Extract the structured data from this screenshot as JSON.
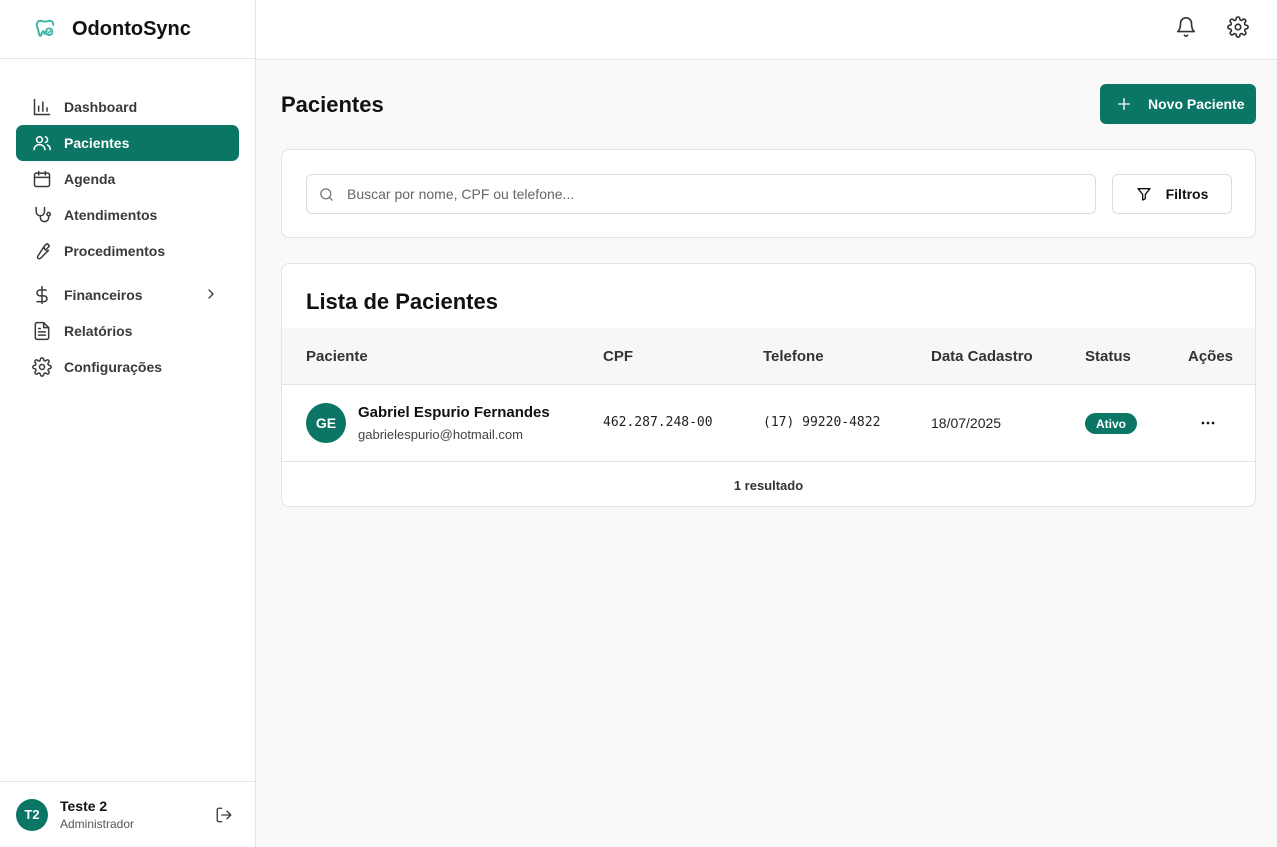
{
  "brand": {
    "name": "OdontoSync",
    "icon": "tooth-icon",
    "accent": "#0b7566"
  },
  "sidebar": {
    "items": [
      {
        "label": "Dashboard",
        "icon": "bar-chart-icon",
        "active": false
      },
      {
        "label": "Pacientes",
        "icon": "users-icon",
        "active": true
      },
      {
        "label": "Agenda",
        "icon": "calendar-icon",
        "active": false
      },
      {
        "label": "Atendimentos",
        "icon": "stethoscope-icon",
        "active": false
      },
      {
        "label": "Procedimentos",
        "icon": "wrench-icon",
        "active": false
      },
      {
        "label": "Financeiros",
        "icon": "dollar-icon",
        "active": false,
        "has_submenu": true
      },
      {
        "label": "Relatórios",
        "icon": "file-text-icon",
        "active": false
      },
      {
        "label": "Configurações",
        "icon": "gear-icon",
        "active": false
      }
    ]
  },
  "user": {
    "initials": "T2",
    "name": "Teste 2",
    "role": "Administrador"
  },
  "topbar": {
    "icons": [
      "bell-icon",
      "gear-icon"
    ]
  },
  "page": {
    "title": "Pacientes",
    "new_button": "Novo Paciente"
  },
  "search": {
    "placeholder": "Buscar por nome, CPF ou telefone...",
    "value": "",
    "filter_label": "Filtros"
  },
  "list": {
    "title": "Lista de Pacientes",
    "columns": [
      "Paciente",
      "CPF",
      "Telefone",
      "Data Cadastro",
      "Status",
      "Ações"
    ],
    "rows": [
      {
        "initials": "GE",
        "name": "Gabriel Espurio Fernandes",
        "email": "gabrielespurio@hotmail.com",
        "cpf": "462.287.248-00",
        "phone": "(17) 99220-4822",
        "date": "18/07/2025",
        "status": "Ativo"
      }
    ],
    "result_count": "1 resultado"
  }
}
